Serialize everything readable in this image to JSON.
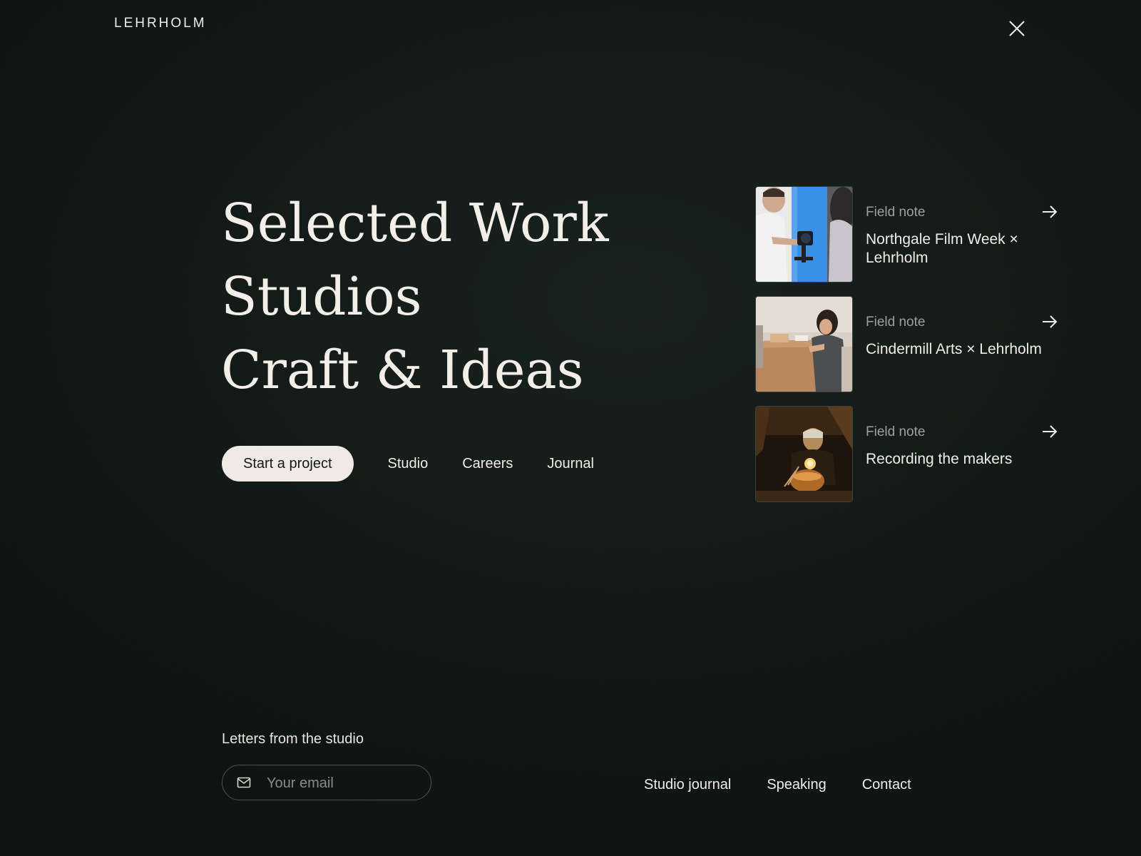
{
  "header": {
    "brand": "LEHRHOLM",
    "close_icon": "close-icon"
  },
  "hero": {
    "lines": [
      "Selected Work",
      "Studios",
      "Craft & Ideas"
    ]
  },
  "actions": {
    "cta_label": "Start a project",
    "nav": [
      "Studio",
      "Careers",
      "Journal"
    ]
  },
  "field_notes": [
    {
      "kicker": "Field note",
      "title": "Northgale Film Week × Lehrholm",
      "image": "videographer-filming-photo",
      "icon": "arrow-right-icon"
    },
    {
      "kicker": "Field note",
      "title": "Cindermill Arts × Lehrholm",
      "image": "artist-at-table-photo",
      "icon": "arrow-right-icon"
    },
    {
      "kicker": "Field note",
      "title": "Recording the makers",
      "image": "craftsman-working-photo",
      "icon": "arrow-right-icon"
    }
  ],
  "newsletter": {
    "label": "Letters from the studio",
    "placeholder": "Your email",
    "icon": "mail-icon"
  },
  "footer": {
    "links": [
      "Studio journal",
      "Speaking",
      "Contact"
    ]
  },
  "colors": {
    "background": "#131b18",
    "text": "#f1ede6",
    "muted": "#9aa29c",
    "cta_background": "#efebe4",
    "cta_text": "#141a17"
  }
}
